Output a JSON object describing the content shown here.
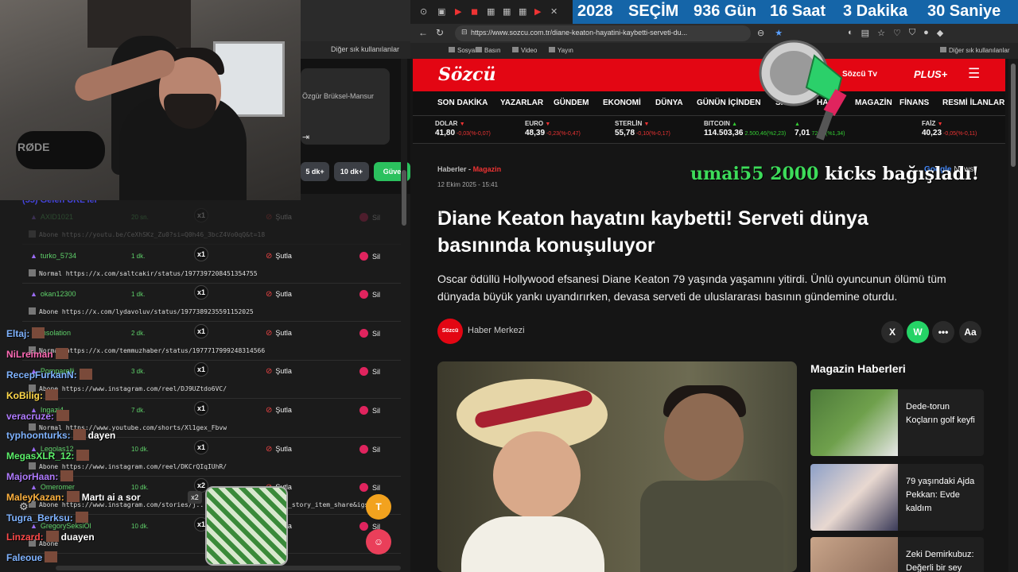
{
  "left": {
    "window_controls": [
      "—",
      "□",
      "✕"
    ],
    "bookmark_label": "Diğer sık kullanılanlar",
    "profile_name": "Özgür Brüksel-Mansur",
    "amount_buttons": [
      "5 dk+",
      "10 dk+",
      "Güve"
    ],
    "queue_title": "(55) Gelen URL'ler",
    "skip_label": "Şutla",
    "delete_label": "Sil",
    "rows": [
      {
        "user": "AXID1021",
        "time": "20 sn.",
        "mult": "x1",
        "type": "Abone",
        "url": "https://youtu.be/CeXhSKz_Zu0?si=Q0h46_3bcZ4Vo0qQ&t=18",
        "faded": true
      },
      {
        "user": "turko_5734",
        "time": "1 dk.",
        "mult": "x1",
        "type": "Normal",
        "url": "https://x.com/saltcakir/status/1977397208451354755",
        "faded": false
      },
      {
        "user": "okan12300",
        "time": "1 dk.",
        "mult": "x1",
        "type": "Abone",
        "url": "https://x.com/lydavoluv/status/1977389235591152025",
        "faded": false
      },
      {
        "user": "insolation",
        "time": "2 dk.",
        "mult": "x1",
        "type": "Normal",
        "url": "https://x.com/temmuzhaber/status/1977717999248314566",
        "faded": false
      },
      {
        "user": "Pomparelli",
        "time": "3 dk.",
        "mult": "x1",
        "type": "Abone",
        "url": "https://www.instagram.com/reel/DJ9UZtdo6VC/",
        "faded": false
      },
      {
        "user": "Ingazi4",
        "time": "7 dk.",
        "mult": "x1",
        "type": "Normal",
        "url": "https://www.youtube.com/shorts/Xl1gex_Fbvw",
        "faded": false
      },
      {
        "user": "Legolas12",
        "time": "10 dk.",
        "mult": "x1",
        "type": "Abone",
        "url": "https://www.instagram.com/reel/DKCrQIqIUhR/",
        "faded": false
      },
      {
        "user": "Omeromer",
        "time": "10 dk.",
        "mult": "x2",
        "type": "Abone",
        "url": "https://www.instagram.com/stories/j.../918754?utm_source=ig_story_item_share&igsh...",
        "faded": false
      },
      {
        "user": "GregorySeksiOl",
        "time": "10 dk.",
        "mult": "x1",
        "type": "Abone",
        "url": "",
        "faded": false
      }
    ],
    "chat": [
      {
        "user": "Eltaj:",
        "msg": "",
        "color": "#7fb3ff"
      },
      {
        "user": "NiLreiman",
        "msg": "",
        "color": "#ff6bb5"
      },
      {
        "user": "RecepFurkanN:",
        "msg": "",
        "color": "#7fb3ff"
      },
      {
        "user": "KoBilig:",
        "msg": "",
        "color": "#ffd84a"
      },
      {
        "user": "veracruze:",
        "msg": "",
        "color": "#b07bff"
      },
      {
        "user": "typhoonturks:",
        "msg": "dayen",
        "color": "#7fb3ff"
      },
      {
        "user": "MegasXLR_12:",
        "msg": "",
        "color": "#5cf06a"
      },
      {
        "user": "MajorHaan:",
        "msg": "",
        "color": "#b07bff"
      },
      {
        "user": "MaleyKazan:",
        "msg": "Martı ai a sor",
        "color": "#ffb23e"
      },
      {
        "user": "Tugra_Berksu:",
        "msg": "",
        "color": "#7fb3ff"
      },
      {
        "user": "Linzard:",
        "msg": "duayen",
        "color": "#ff4a4a"
      },
      {
        "user": "Faleoue",
        "msg": "",
        "color": "#7fb3ff"
      }
    ],
    "jar_badge": "x2",
    "btn_t": "T"
  },
  "browser": {
    "countdown": {
      "year": "2028",
      "label": "SEÇİM",
      "days": "936 Gün",
      "hours": "16 Saat",
      "minutes": "3 Dakika",
      "seconds": "30 Saniye"
    },
    "url": "https://www.sozcu.com.tr/diane-keaton-hayatini-kaybetti-serveti-du...",
    "bookmarks": [
      "Sosyal",
      "Basın",
      "Video",
      "Yayın"
    ],
    "bookmark_other": "Diğer sık kullanılanlar"
  },
  "site": {
    "logo": "Sözcü",
    "tv": "Sözcü Tv",
    "plus": "PLUS+",
    "nav": [
      "SON DAKİKA",
      "YAZARLAR",
      "GÜNDEM",
      "EKONOMİ",
      "DÜNYA",
      "GÜNÜN İÇİNDEN",
      "SPOR",
      "HAYAT",
      "MAGAZİN",
      "FİNANS",
      "RESMİ İLANLAR"
    ],
    "ticker": [
      {
        "name": "DOLAR",
        "value": "41,80",
        "change": "-0,03(%-0,07)",
        "up": false
      },
      {
        "name": "EURO",
        "value": "48,39",
        "change": "-0,23(%-0,47)",
        "up": false
      },
      {
        "name": "STERLİN",
        "value": "55,78",
        "change": "-0,10(%-0,17)",
        "up": false
      },
      {
        "name": "BITCOIN",
        "value": "114.503,36",
        "change": "2.500,46(%2,23)",
        "up": true
      },
      {
        "name": "",
        "value": "7,01",
        "change": "72,47(%1,34)",
        "up": true
      },
      {
        "name": "FAİZ",
        "value": "40,23",
        "change": "-0,05(%-0,11)",
        "up": false
      }
    ]
  },
  "article": {
    "crumb_section": "Haberler",
    "crumb_sep": "-",
    "crumb_cat": "Magazin",
    "date": "12 Ekim 2025 - 15:41",
    "google_news_prefix": "Google",
    "google_news_suffix": "News",
    "headline": "Diane Keaton hayatını kaybetti! Serveti dünya basınında konuşuluyor",
    "lead": "Oscar ödüllü Hollywood efsanesi Diane Keaton 79 yaşında yaşamını yitirdi. Ünlü oyuncunun ölümü tüm dünyada büyük yankı uyandırırken, devasa serveti de uluslararası basının gündemine oturdu.",
    "author": "Haber Merkezi",
    "author_logo": "Sözcü",
    "share": [
      "X",
      "W",
      "•••",
      "Aa"
    ]
  },
  "sidebar": {
    "title": "Magazin Haberleri",
    "items": [
      {
        "title": "Dede-torun Koçların golf keyfi"
      },
      {
        "title": "79 yaşındaki Ajda Pekkan: Evde kaldım"
      },
      {
        "title": "Zeki Demirkubuz: Değerli bir sey"
      }
    ]
  },
  "donation": {
    "user": "umai55",
    "amount": "2000",
    "text": "kicks bağışladı!"
  }
}
